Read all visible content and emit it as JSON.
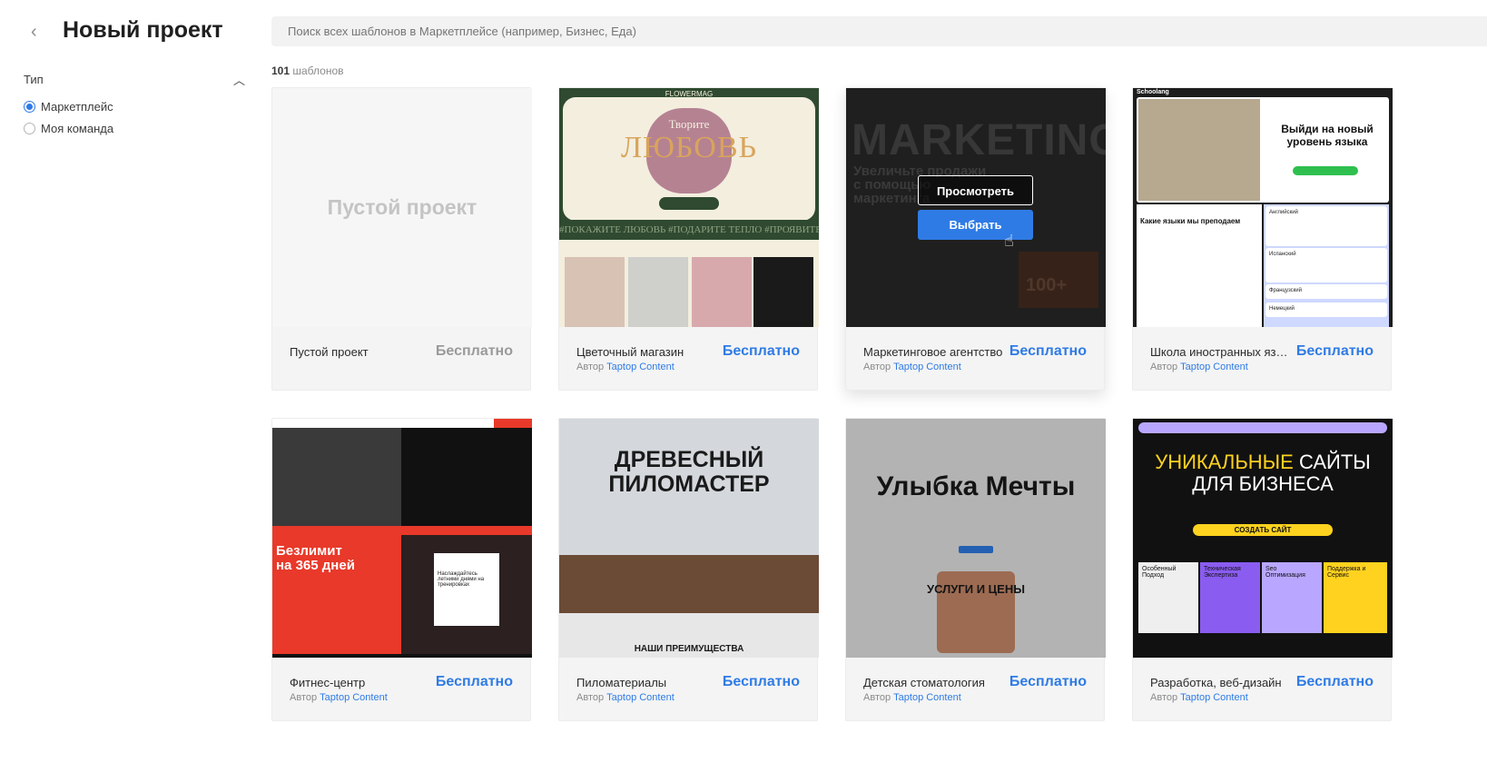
{
  "header": {
    "back_icon": "chevron-left-icon",
    "title": "Новый проект"
  },
  "filter": {
    "label": "Тип",
    "options": [
      {
        "label": "Маркетплейс",
        "selected": true
      },
      {
        "label": "Моя команда",
        "selected": false
      }
    ]
  },
  "search": {
    "placeholder": "Поиск всех шаблонов в Маркетплейсе (например, Бизнес, Еда)"
  },
  "count": {
    "number": "101",
    "label": "шаблонов"
  },
  "accent_color": "#2f7be5",
  "hover_actions": {
    "view": "Просмотреть",
    "select": "Выбрать"
  },
  "templates": [
    {
      "name": "Пустой проект",
      "author_prefix": "",
      "author": "",
      "price": "Бесплатно",
      "preview": {
        "text": "Пустой проект"
      }
    },
    {
      "name": "Цветочный магазин",
      "author_prefix": "Автор",
      "author": "Taptop Content",
      "price": "Бесплатно",
      "preview": {
        "brand": "FLOWERMAG",
        "line1": "Творите",
        "line2": "ЛЮБОВЬ",
        "ticker": "#ПОКАЖИТЕ ЛЮБОВЬ #ПОДАРИТЕ ТЕПЛО #ПРОЯВИТЕ"
      }
    },
    {
      "name": "Маркетинговое агентство",
      "author_prefix": "Автор",
      "author": "Taptop Content",
      "price": "Бесплатно",
      "preview": {
        "headline": "MARKETING",
        "sub1": "Увеличьте продажи",
        "sub2": "с помощью",
        "sub3": "маркетинга",
        "stat": "100+"
      }
    },
    {
      "name": "Школа иностранных языков",
      "author_prefix": "Автор",
      "author": "Taptop Content",
      "price": "Бесплатно",
      "preview": {
        "brand": "Schoolang",
        "hero1": "Выйди на новый",
        "hero2": "уровень языка",
        "section": "Какие языки мы преподаем",
        "langs": [
          "Английский",
          "Испанский",
          "Французский",
          "Немецкий"
        ]
      }
    },
    {
      "name": "Фитнес-центр",
      "author_prefix": "Автор",
      "author": "Taptop Content",
      "price": "Бесплатно",
      "preview": {
        "line1": "Безлимит",
        "line2": "на 365 дней",
        "note": "Наслаждайтесь летними днями на тренировках"
      }
    },
    {
      "name": "Пиломатериалы",
      "author_prefix": "Автор",
      "author": "Taptop Content",
      "price": "Бесплатно",
      "preview": {
        "line1": "ДРЕВЕСНЫЙ",
        "line2": "ПИЛОМАСТЕР",
        "footer": "НАШИ ПРЕИМУЩЕСТВА"
      }
    },
    {
      "name": "Детская стоматология",
      "author_prefix": "Автор",
      "author": "Taptop Content",
      "price": "Бесплатно",
      "preview": {
        "headline": "Улыбка Мечты",
        "sub": "УСЛУГИ И ЦЕНЫ"
      }
    },
    {
      "name": "Разработка, веб-дизайн",
      "author_prefix": "Автор",
      "author": "Taptop Content",
      "price": "Бесплатно",
      "preview": {
        "hl_yellow": "УНИКАЛЬНЫЕ",
        "hl_white": "САЙТЫ",
        "line2": "ДЛЯ БИЗНЕСА",
        "cta": "СОЗДАТЬ САЙТ",
        "tiles": [
          "Особенный Подход",
          "Техническая Экспертиза",
          "Seo Оптимизация",
          "Поддержка и Сервис"
        ]
      }
    }
  ]
}
